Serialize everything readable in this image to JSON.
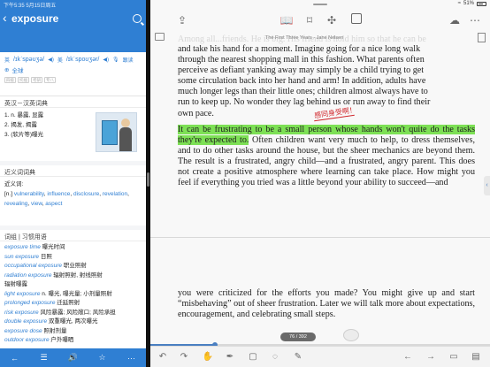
{
  "dictionary": {
    "status_time": "下午5:35  5月15日周五",
    "word": "exposure",
    "pronunciation_uk": "/ɪkˈspəʊʒə/",
    "pronunciation_us": "/ɪkˈspoʊʒər/",
    "follow_read_label": "跟读",
    "global_label": "全球",
    "level_tags": [
      "四级",
      "托福",
      "考研",
      "专八"
    ],
    "ec_section_title": "英汉－汉英词典",
    "senses": [
      "1. n. 暴露, 显露",
      "2. 揭发, 揭露",
      "3. (软片等)曝光"
    ],
    "synonym_section_title": "近义词词典",
    "synonym_heading": "近义词:",
    "synonym_pos": "[n.]",
    "synonyms": [
      "vulnerability",
      "influence",
      "disclosure",
      "revelation",
      "revealing",
      "view",
      "aspect"
    ],
    "phrase_section_title": "词组 | 习惯用语",
    "phrases": [
      {
        "en": "exposure time",
        "zh": "曝光时间"
      },
      {
        "en": "sun exposure",
        "zh": "日照"
      },
      {
        "en": "occupational exposure",
        "zh": "职业照射"
      },
      {
        "en": "radiation exposure",
        "zh": "辐射照射, 射线照射"
      },
      {
        "en": "",
        "zh": "辐射曝露"
      },
      {
        "en": "light exposure",
        "zh": "n. 曝光, 曝光量; 小剂量照射"
      },
      {
        "en": "prolonged exposure",
        "zh": "迁延照射"
      },
      {
        "en": "risk exposure",
        "zh": "风险暴露; 风险敞口; 风险承担"
      },
      {
        "en": "double exposure",
        "zh": "双重曝光, 两次曝光"
      },
      {
        "en": "exposure dose",
        "zh": "照射剂量"
      },
      {
        "en": "outdoor exposure",
        "zh": "户外曝晒"
      }
    ],
    "tabbar": [
      "←",
      "☰",
      "🔊",
      "☆",
      "···"
    ]
  },
  "reader": {
    "status": {
      "wifi": "≈",
      "battery": "51%"
    },
    "book_header": "The First Three Years - Jane Nelsen",
    "ghost_line": "Among all...friends. He is big. His friend is hold him so that he can be",
    "paragraph1_lines": [
      "and take his hand for a moment. Imagine going for a nice long walk",
      "through the nearest shopping mall in this fashion. What parents often",
      "perceive as defiant yanking away may simply be a child trying to get",
      "some circulation back into her hand and arm! In addition, adults have",
      "much longer legs than their little ones; children almost always have to",
      "run to keep up. No wonder they lag behind us or run away to find their",
      "own pace."
    ],
    "highlight_text": "It can be frustrating to be a small person whose hands won't quite do the tasks they're expected to.",
    "paragraph1_rest": " Often children want very much to help, to dress themselves, and to do other tasks around the house, but the sheer mechanics are beyond them. The result is a frustrated, angry child—and a frustrated, angry parent. This does not create a positive atmosphere where learning can take place. How might you feel if everything you tried was a little beyond your ability to succeed—and",
    "annotation": "感同身受啊！",
    "paragraph2": "you were criticized for the efforts you made? You might give up and start “misbehaving” out of sheer frustration. Later we will talk more about expectations, encouragement, and celebrating small steps.",
    "page_counter": "76 / 392",
    "reading_progress": 0.19,
    "accent_color": "#4a7fc1",
    "highlight_color": "#7de055"
  }
}
